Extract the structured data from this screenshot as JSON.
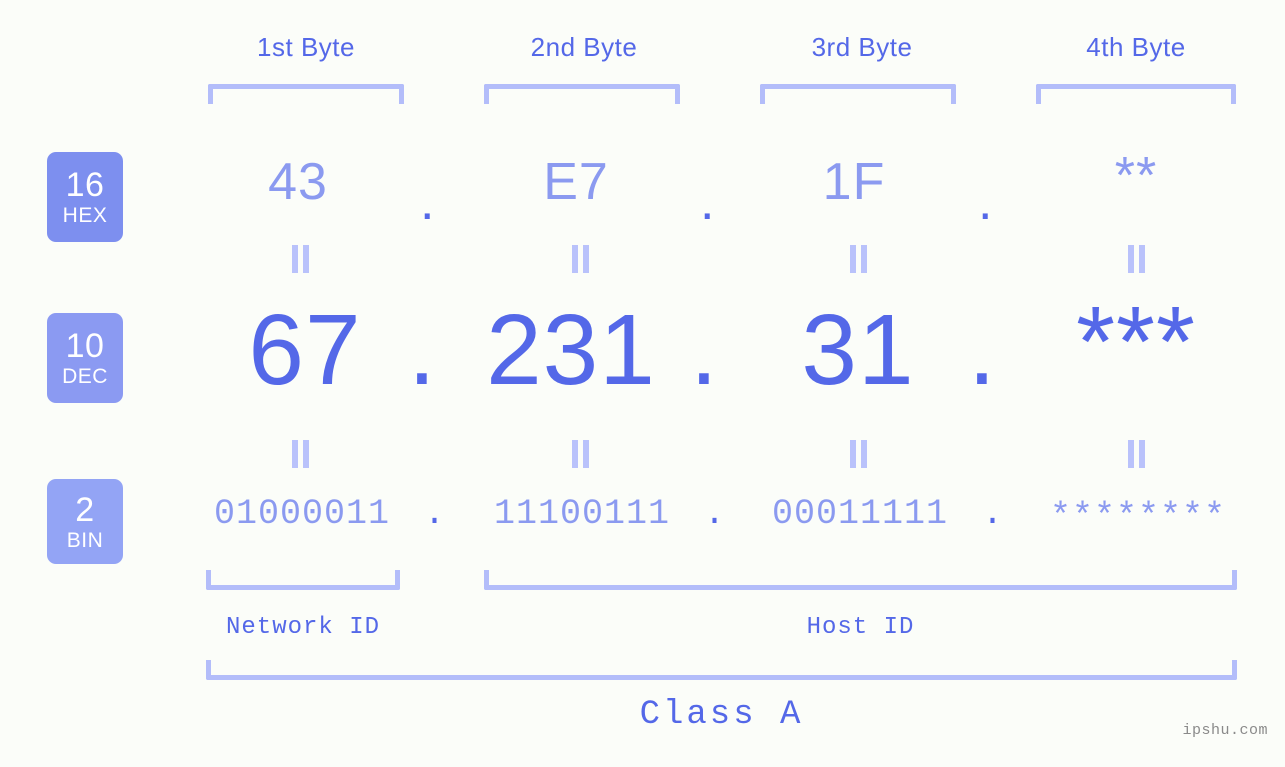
{
  "meta": {
    "background": "#fbfdf9",
    "accent_strong": "#5468e8",
    "accent_light": "#8b9af0",
    "bracket_color": "#b3bdfa",
    "watermark": "ipshu.com"
  },
  "columns": [
    {
      "header": "1st Byte"
    },
    {
      "header": "2nd Byte"
    },
    {
      "header": "3rd Byte"
    },
    {
      "header": "4th Byte"
    }
  ],
  "rows": {
    "hex": {
      "badge_num": "16",
      "badge_abbr": "HEX",
      "values": [
        "43",
        "E7",
        "1F",
        "**"
      ],
      "separator": "."
    },
    "dec": {
      "badge_num": "10",
      "badge_abbr": "DEC",
      "values": [
        "67",
        "231",
        "31",
        "***"
      ],
      "separator": "."
    },
    "bin": {
      "badge_num": "2",
      "badge_abbr": "BIN",
      "values": [
        "01000011",
        "11100111",
        "00011111",
        "********"
      ],
      "separator": "."
    }
  },
  "equals_symbol": "=",
  "sections": {
    "network_id": "Network ID",
    "host_id": "Host ID",
    "class": "Class A"
  }
}
